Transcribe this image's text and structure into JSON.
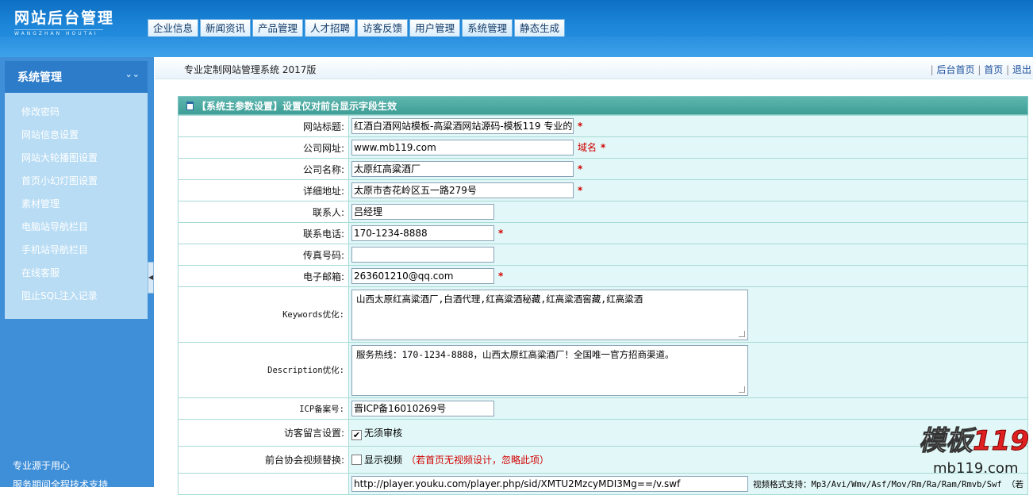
{
  "header": {
    "logo_title": "网站后台管理",
    "logo_sub": "WANGZHAN HOUTAI",
    "nav_tabs": [
      "企业信息",
      "新闻资讯",
      "产品管理",
      "人才招聘",
      "访客反馈",
      "用户管理",
      "系统管理",
      "静态生成"
    ],
    "active_tab": "系统管理"
  },
  "sidebar": {
    "title": "系统管理",
    "collapse_glyph": "⌄⌄",
    "items": [
      "修改密码",
      "网站信息设置",
      "网站大轮播图设置",
      "首页小幻灯图设置",
      "素材管理",
      "电脑站导航栏目",
      "手机站导航栏目",
      "在线客服",
      "阻止SQL注入记录"
    ],
    "footer_line1": "专业源于用心",
    "footer_line2": "服务期间全程技术支持",
    "splitter_glyph": "◀"
  },
  "topbar": {
    "title": "专业定制网站管理系统 2017版",
    "sep": "|",
    "links": [
      "后台首页",
      "首页",
      "退出"
    ]
  },
  "form": {
    "caption": "【系统主参数设置】设置仅对前台显示字段生效",
    "required_mark": "*",
    "rows": {
      "site_title": {
        "label": "网站标题:",
        "value": "红酒白酒网站模板-高粱酒网站源码-模板119 专业的"
      },
      "company_url": {
        "label": "公司网址:",
        "value": "www.mb119.com",
        "note": "域名"
      },
      "company_name": {
        "label": "公司名称:",
        "value": "太原红高粱酒厂"
      },
      "address": {
        "label": "详细地址:",
        "value": "太原市杏花岭区五一路279号"
      },
      "contact": {
        "label": "联系人:",
        "value": "吕经理"
      },
      "phone": {
        "label": "联系电话:",
        "value": "170-1234-8888"
      },
      "fax": {
        "label": "传真号码:",
        "value": ""
      },
      "email": {
        "label": "电子邮箱:",
        "value": "263601210@qq.com"
      },
      "keywords": {
        "label": "Keywords优化:",
        "value": "山西太原红高粱酒厂,白酒代理,红高粱酒秘藏,红高粱酒窖藏,红高粱酒"
      },
      "description": {
        "label": "Description优化:",
        "value": "服务热线：170-1234-8888，山西太原红高粱酒厂！全国唯一官方招商渠道。"
      },
      "icp": {
        "label": "ICP备案号:",
        "value": "晋ICP备16010269号"
      },
      "guestbook": {
        "label": "访客留言设置:",
        "checked": true,
        "check_label": "无须审核"
      },
      "video_replace": {
        "label": "前台协会视频替换:",
        "checked": false,
        "check_label": "显示视频",
        "note": "（若首页无视频设计，忽略此项）"
      },
      "video_url": {
        "label": "",
        "value": "http://player.youku.com/player.php/sid/XMTU2MzcyMDI3Mg==/v.swf",
        "note": "视频格式支持：Mp3/Avi/Wmv/Asf/Mov/Rm/Ra/Ram/Rmvb/Swf （若"
      }
    }
  },
  "watermark": {
    "line1_text": "模板",
    "line1_num": "119",
    "line2": "mb119.com"
  },
  "colors": {
    "header_blue": "#1d86d8",
    "sidebar_blue": "#3f8fd8",
    "panel_light": "#b8dcf4",
    "caption_teal": "#4aa8a0",
    "field_bg": "#e2f7f7",
    "required_red": "#d10000"
  }
}
